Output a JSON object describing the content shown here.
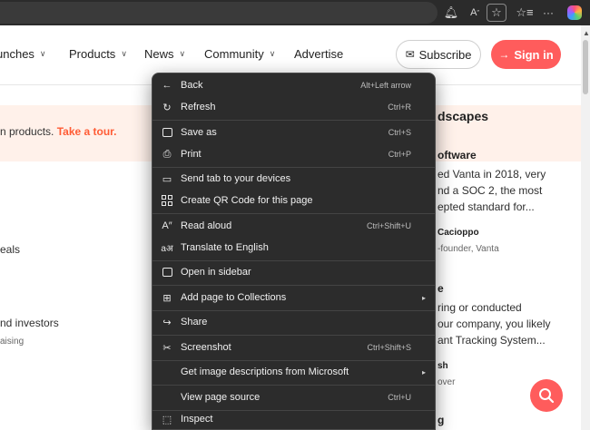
{
  "browser": {
    "icons": [
      "bell-icon",
      "read-aloud-icon",
      "favorite-star-icon",
      "favorites-icon",
      "more-icon",
      "copilot-icon"
    ]
  },
  "nav": {
    "items": [
      {
        "label": "unches",
        "has_chevron": true
      },
      {
        "label": "Products",
        "has_chevron": true
      },
      {
        "label": "News",
        "has_chevron": true
      },
      {
        "label": "Community",
        "has_chevron": true
      },
      {
        "label": "Advertise",
        "has_chevron": false
      }
    ],
    "subscribe_label": "Subscribe",
    "signin_label": "Sign in"
  },
  "banner": {
    "text": "n products.",
    "link": "Take a tour."
  },
  "page_left": {
    "line1": "eals",
    "line2": "nd investors",
    "line3": "aising"
  },
  "page_right": {
    "heading": "dscapes",
    "company": "oftware",
    "desc1": "ed Vanta in 2018, very",
    "desc2": "nd a SOC 2, the most",
    "desc3": "epted standard for...",
    "author": "Cacioppo",
    "role": "-founder, Vanta",
    "h2": "e",
    "p1": "ring or conducted",
    "p2": "our company, you likely",
    "p3": "ant Tracking System...",
    "author2": "sh",
    "role2": "over",
    "h3": "g"
  },
  "menu": {
    "items": [
      {
        "label": "Back",
        "shortcut": "Alt+Left arrow",
        "icon": "back-arrow-icon"
      },
      {
        "label": "Refresh",
        "shortcut": "Ctrl+R",
        "icon": "refresh-icon"
      },
      {
        "label": "Save as",
        "shortcut": "Ctrl+S",
        "icon": "save-icon"
      },
      {
        "label": "Print",
        "shortcut": "Ctrl+P",
        "icon": "print-icon"
      },
      {
        "label": "Send tab to your devices",
        "shortcut": "",
        "icon": "devices-icon"
      },
      {
        "label": "Create QR Code for this page",
        "shortcut": "",
        "icon": "qr-code-icon"
      },
      {
        "label": "Read aloud",
        "shortcut": "Ctrl+Shift+U",
        "icon": "read-aloud-icon"
      },
      {
        "label": "Translate to English",
        "shortcut": "",
        "icon": "translate-icon"
      },
      {
        "label": "Open in sidebar",
        "shortcut": "",
        "icon": "sidebar-icon"
      },
      {
        "label": "Add page to Collections",
        "shortcut": "",
        "icon": "collections-icon",
        "submenu": true
      },
      {
        "label": "Share",
        "shortcut": "",
        "icon": "share-icon"
      },
      {
        "label": "Screenshot",
        "shortcut": "Ctrl+Shift+S",
        "icon": "screenshot-icon"
      },
      {
        "label": "Get image descriptions from Microsoft",
        "shortcut": "",
        "icon": "",
        "submenu": true
      },
      {
        "label": "View page source",
        "shortcut": "Ctrl+U",
        "icon": ""
      },
      {
        "label": "Inspect",
        "shortcut": "",
        "icon": "inspect-icon"
      }
    ]
  },
  "colors": {
    "accent": "#ff5c5c",
    "tour_link": "#ff5c35",
    "banner_bg": "#fff1ea",
    "menu_bg": "#2c2c2c"
  }
}
